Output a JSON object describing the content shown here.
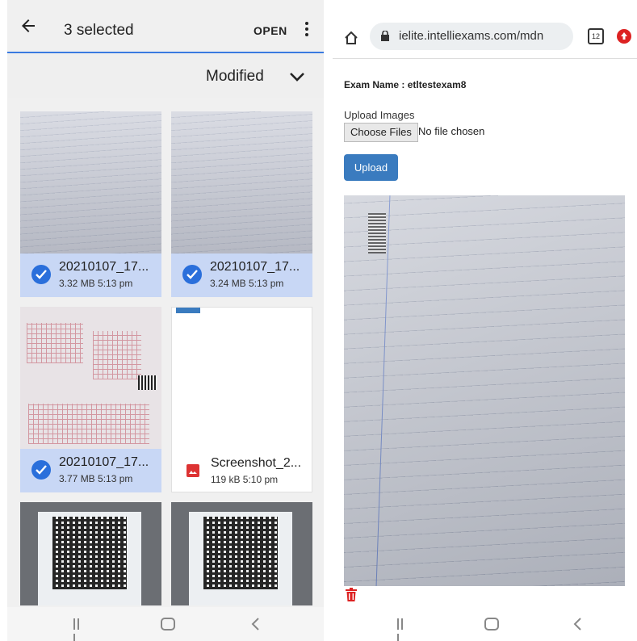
{
  "file_picker": {
    "title": "3 selected",
    "open_label": "OPEN",
    "sort_label": "Modified",
    "files": [
      {
        "name": "20210107_17...",
        "meta": "3.32 MB 5:13 pm",
        "selected": true
      },
      {
        "name": "20210107_17...",
        "meta": "3.24 MB 5:13 pm",
        "selected": true
      },
      {
        "name": "20210107_17...",
        "meta": "3.77 MB 5:13 pm",
        "selected": true
      },
      {
        "name": "Screenshot_2...",
        "meta": "119 kB 5:10 pm",
        "selected": false
      }
    ]
  },
  "browser": {
    "url": "ielite.intelliexams.com/mdn",
    "tab_count": "12",
    "exam_name": "Exam Name : etltestexam8",
    "upload_label": "Upload Images",
    "choose_files_label": "Choose Files",
    "no_file_text": "No file chosen",
    "upload_button": "Upload"
  },
  "colors": {
    "accent_blue": "#2a6fdb",
    "selected_bg": "#c8d7f5",
    "upload_button": "#3a7bbf",
    "delete_red": "#d22222"
  },
  "icons": [
    "back-arrow-icon",
    "more-vert-icon",
    "chevron-down-icon",
    "check-circle-icon",
    "image-icon",
    "home-icon",
    "lock-icon",
    "tab-switcher-icon",
    "extension-icon",
    "trash-icon",
    "nav-recents-icon",
    "nav-home-icon",
    "nav-back-icon"
  ]
}
